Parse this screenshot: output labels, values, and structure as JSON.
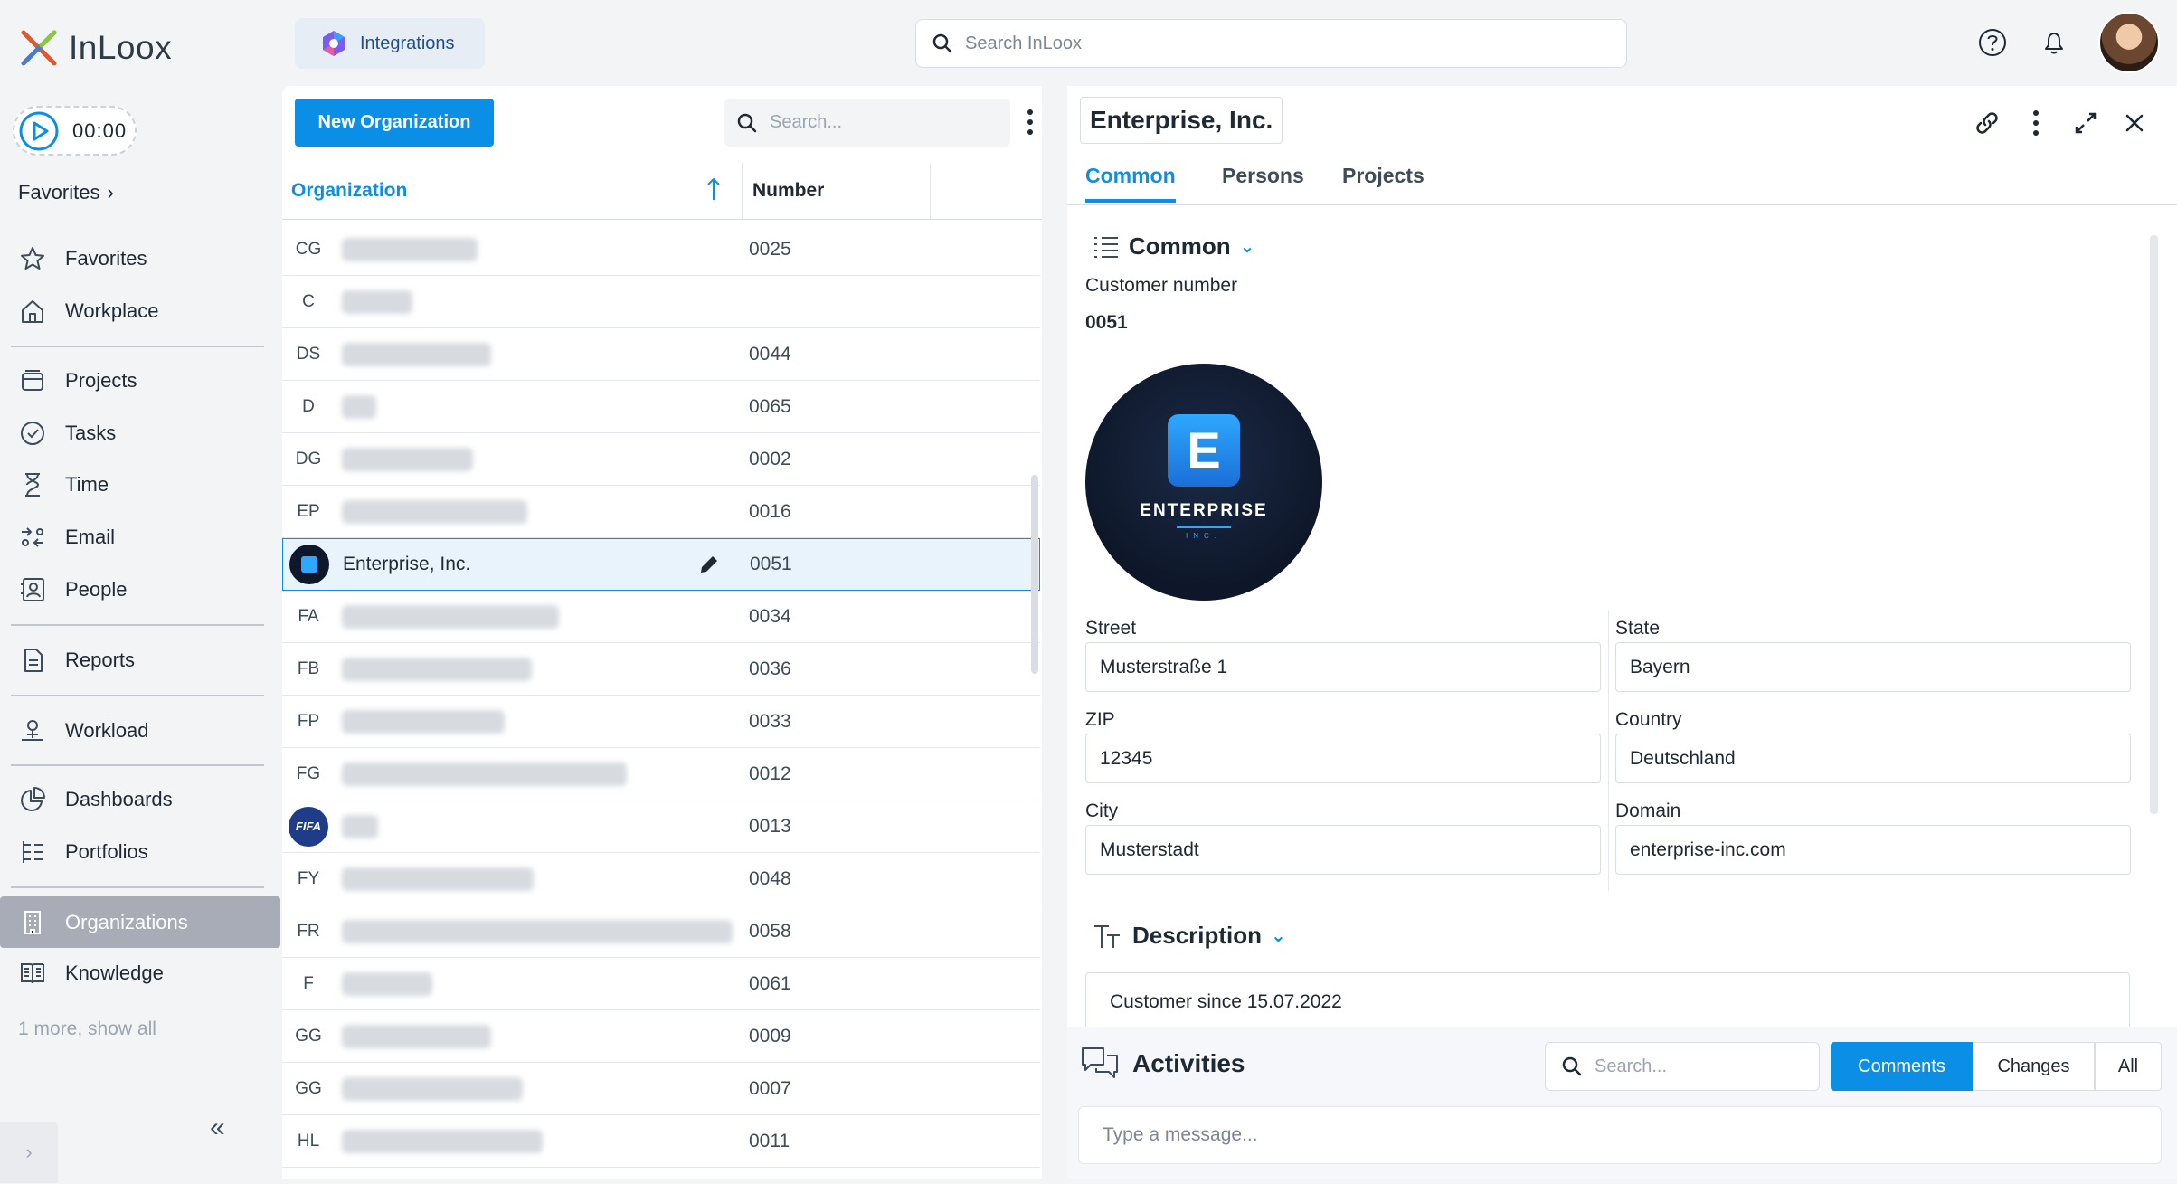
{
  "app": {
    "name": "InLoox"
  },
  "timer": {
    "value": "00:00"
  },
  "sidebar": {
    "favorites_header": "Favorites",
    "items": [
      {
        "label": "Favorites",
        "icon": "star-icon"
      },
      {
        "label": "Workplace",
        "icon": "home-icon"
      },
      {
        "label": "Projects",
        "icon": "layers-icon"
      },
      {
        "label": "Tasks",
        "icon": "check-circle-icon"
      },
      {
        "label": "Time",
        "icon": "hourglass-icon"
      },
      {
        "label": "Email",
        "icon": "email-icon"
      },
      {
        "label": "People",
        "icon": "contact-icon"
      },
      {
        "label": "Reports",
        "icon": "report-icon"
      },
      {
        "label": "Workload",
        "icon": "workload-icon"
      },
      {
        "label": "Dashboards",
        "icon": "pie-chart-icon"
      },
      {
        "label": "Portfolios",
        "icon": "portfolio-icon"
      },
      {
        "label": "Organizations",
        "icon": "building-icon",
        "active": true
      },
      {
        "label": "Knowledge",
        "icon": "book-icon"
      }
    ],
    "show_more": "1 more, show all"
  },
  "topbar": {
    "integrations_label": "Integrations",
    "search_placeholder": "Search InLoox"
  },
  "list": {
    "new_button": "New Organization",
    "search_placeholder": "Search...",
    "columns": {
      "organization": "Organization",
      "number": "Number"
    },
    "rows": [
      {
        "initials": "CG",
        "name": "",
        "number": "0025"
      },
      {
        "initials": "C",
        "name": "",
        "number": ""
      },
      {
        "initials": "DS",
        "name": "",
        "number": "0044"
      },
      {
        "initials": "D",
        "name": "",
        "number": "0065"
      },
      {
        "initials": "DG",
        "name": "",
        "number": "0002"
      },
      {
        "initials": "EP",
        "name": "",
        "number": "0016"
      },
      {
        "initials": "",
        "name": "Enterprise, Inc.",
        "number": "0051",
        "selected": true
      },
      {
        "initials": "FA",
        "name": "",
        "number": "0034"
      },
      {
        "initials": "FB",
        "name": "",
        "number": "0036"
      },
      {
        "initials": "FP",
        "name": "",
        "number": "0033"
      },
      {
        "initials": "FG",
        "name": "",
        "number": "0012"
      },
      {
        "initials": "FIFA",
        "name": "",
        "number": "0013"
      },
      {
        "initials": "FY",
        "name": "",
        "number": "0048"
      },
      {
        "initials": "FR",
        "name": "",
        "number": "0058"
      },
      {
        "initials": "F",
        "name": "",
        "number": "0061"
      },
      {
        "initials": "GG",
        "name": "",
        "number": "0009"
      },
      {
        "initials": "GG",
        "name": "",
        "number": "0007"
      },
      {
        "initials": "HL",
        "name": "",
        "number": "0011"
      }
    ]
  },
  "detail": {
    "title": "Enterprise, Inc.",
    "tabs": [
      "Common",
      "Persons",
      "Projects"
    ],
    "common_section": "Common",
    "customer_number_label": "Customer number",
    "customer_number": "0051",
    "logo": {
      "word": "ENTERPRISE",
      "letter": "E",
      "sub": "INC."
    },
    "fields": {
      "street_label": "Street",
      "street": "Musterstraße 1",
      "state_label": "State",
      "state": "Bayern",
      "zip_label": "ZIP",
      "zip": "12345",
      "country_label": "Country",
      "country": "Deutschland",
      "city_label": "City",
      "city": "Musterstadt",
      "domain_label": "Domain",
      "domain": "enterprise-inc.com"
    },
    "description_section": "Description",
    "description": "Customer since 15.07.2022"
  },
  "activities": {
    "title": "Activities",
    "search_placeholder": "Search...",
    "filters": [
      "Comments",
      "Changes",
      "All"
    ],
    "message_placeholder": "Type a message..."
  },
  "colors": {
    "accent": "#0b8fe6",
    "sidebar_active": "#a7acb6"
  }
}
